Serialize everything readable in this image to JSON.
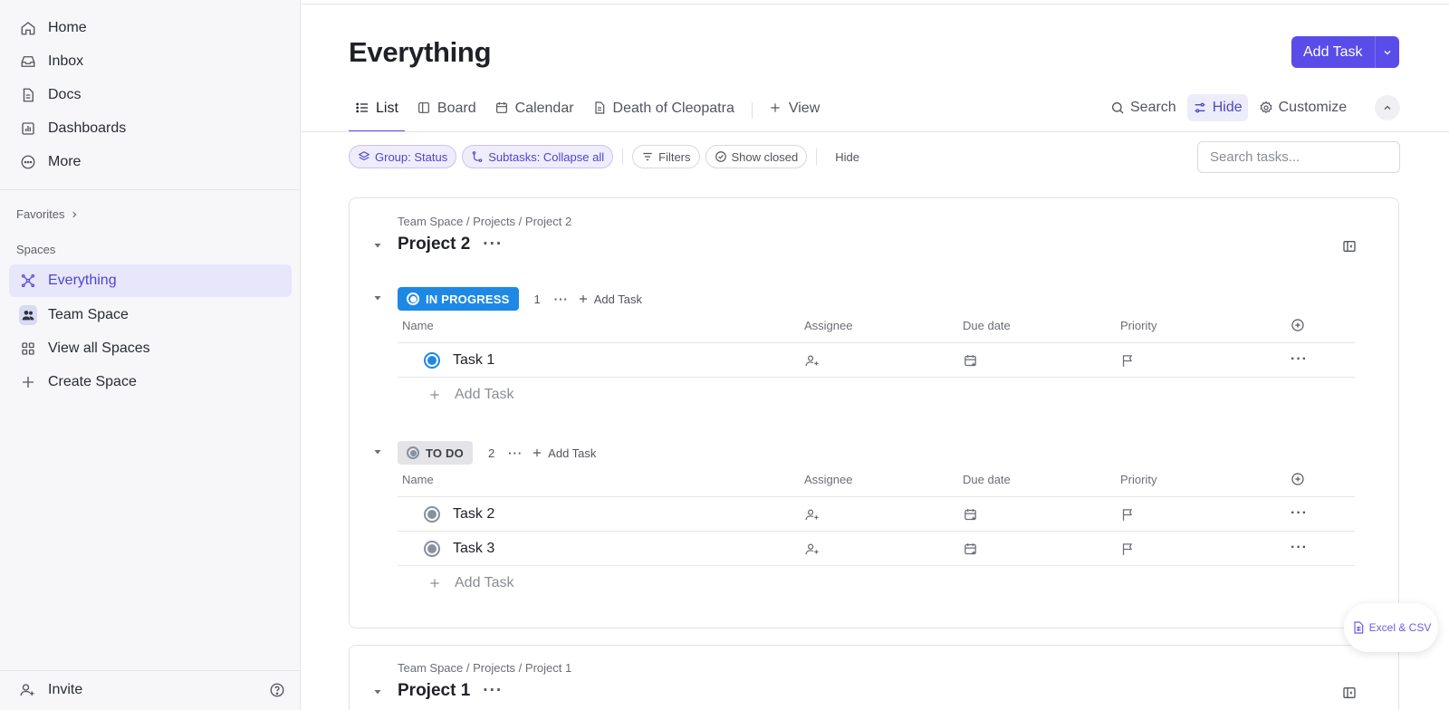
{
  "sidebar": {
    "nav": [
      "Home",
      "Inbox",
      "Docs",
      "Dashboards",
      "More"
    ],
    "favorites_label": "Favorites",
    "spaces_label": "Spaces",
    "spaces": [
      "Everything",
      "Team Space",
      "View all Spaces",
      "Create Space"
    ],
    "invite_label": "Invite"
  },
  "header": {
    "title": "Everything",
    "add_task_label": "Add Task"
  },
  "tabs": [
    "List",
    "Board",
    "Calendar",
    "Death of Cleopatra",
    "View"
  ],
  "tools": {
    "search": "Search",
    "hide": "Hide",
    "customize": "Customize"
  },
  "filters": {
    "group": "Group: Status",
    "subtasks": "Subtasks: Collapse all",
    "filters": "Filters",
    "show_closed": "Show closed",
    "hide": "Hide",
    "search_placeholder": "Search tasks..."
  },
  "columns": {
    "name": "Name",
    "assignee": "Assignee",
    "due_date": "Due date",
    "priority": "Priority"
  },
  "projects": [
    {
      "breadcrumb": "Team Space / Projects / Project 2",
      "title": "Project 2",
      "groups": [
        {
          "status": "IN PROGRESS",
          "count": "1",
          "add_label": "Add Task",
          "tasks": [
            "Task 1"
          ],
          "add_row_label": "Add Task"
        },
        {
          "status": "TO DO",
          "count": "2",
          "add_label": "Add Task",
          "tasks": [
            "Task 2",
            "Task 3"
          ],
          "add_row_label": "Add Task"
        }
      ]
    },
    {
      "breadcrumb": "Team Space / Projects / Project 1",
      "title": "Project 1"
    }
  ],
  "export_label": "Excel & CSV",
  "colors": {
    "accent": "#5a4ce8",
    "in_progress": "#1e88e5",
    "todo": "#87909e"
  }
}
